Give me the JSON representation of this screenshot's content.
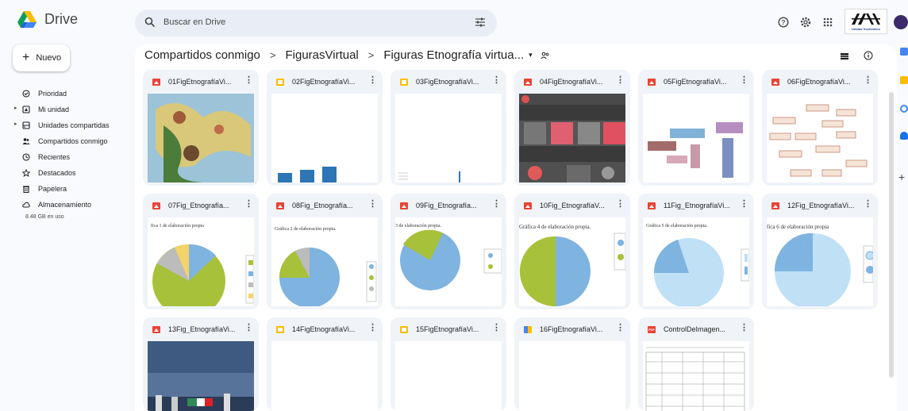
{
  "app": {
    "name": "Drive"
  },
  "search": {
    "placeholder": "Buscar en Drive"
  },
  "header": {
    "org_logo_text": "UAM",
    "org_logo_subtext": "Unidad Xochimilco"
  },
  "sidebar": {
    "new_label": "Nuevo",
    "items": [
      {
        "label": "Prioridad",
        "icon": "priority-icon"
      },
      {
        "label": "Mi unidad",
        "icon": "my-drive-icon"
      },
      {
        "label": "Unidades compartidas",
        "icon": "shared-drives-icon"
      },
      {
        "label": "Compartidos conmigo",
        "icon": "shared-with-me-icon"
      },
      {
        "label": "Recientes",
        "icon": "clock-icon"
      },
      {
        "label": "Destacados",
        "icon": "star-icon"
      },
      {
        "label": "Papelera",
        "icon": "trash-icon"
      },
      {
        "label": "Almacenamiento",
        "icon": "cloud-icon"
      }
    ],
    "storage_used": "8.48 GB en uso"
  },
  "breadcrumb": {
    "items": [
      "Compartidos conmigo",
      "FigurasVirtual",
      "Figuras Etnografía virtua..."
    ],
    "separator": ">",
    "dropdown": "▾"
  },
  "files": [
    {
      "name": "01FigEtnografíaVi...",
      "type": "image"
    },
    {
      "name": "02FigEtnografíaVi...",
      "type": "slides"
    },
    {
      "name": "03FigEtnografíaVi...",
      "type": "slides"
    },
    {
      "name": "04FigEtnografíaVi...",
      "type": "image"
    },
    {
      "name": "05FigEtnografíaVi...",
      "type": "image"
    },
    {
      "name": "06FigEtnografíaVi...",
      "type": "image"
    },
    {
      "name": "07Fig_Etnografía...",
      "type": "image",
      "thumb_text": "fica 1 de elaboración propia"
    },
    {
      "name": "08Fig_Etnografía...",
      "type": "image",
      "thumb_text": "Gráfica 2 de elaboración propia."
    },
    {
      "name": "09Fig_Etnografía...",
      "type": "image",
      "thumb_text": "3 de elaboración propia."
    },
    {
      "name": "10Fig_EtnografíaV...",
      "type": "image",
      "thumb_text": "Gráfica 4 de elaboración propia."
    },
    {
      "name": "11Fig_EtnografíaVi...",
      "type": "image",
      "thumb_text": "Gráfica 5 de elaboración propia."
    },
    {
      "name": "12Fig_EtnografíaVi...",
      "type": "image",
      "thumb_text": "fica 6 de elaboración propia"
    },
    {
      "name": "13Fig_EtnografíaVi...",
      "type": "image"
    },
    {
      "name": "14FigEtnografíaVi...",
      "type": "slides"
    },
    {
      "name": "15FigEtnografíaVi...",
      "type": "slides"
    },
    {
      "name": "16FigEtnografíaVi...",
      "type": "slidesb"
    },
    {
      "name": "ControlDeImagen...",
      "type": "pdf"
    }
  ],
  "colors": {
    "surface": "#f8fafd",
    "search_bg": "#e9eef6",
    "card_bg": "#f0f4f9",
    "pie_green": "#a8c13a",
    "pie_blue": "#7fb3e0",
    "pie_light_blue": "#bfe0f5"
  }
}
